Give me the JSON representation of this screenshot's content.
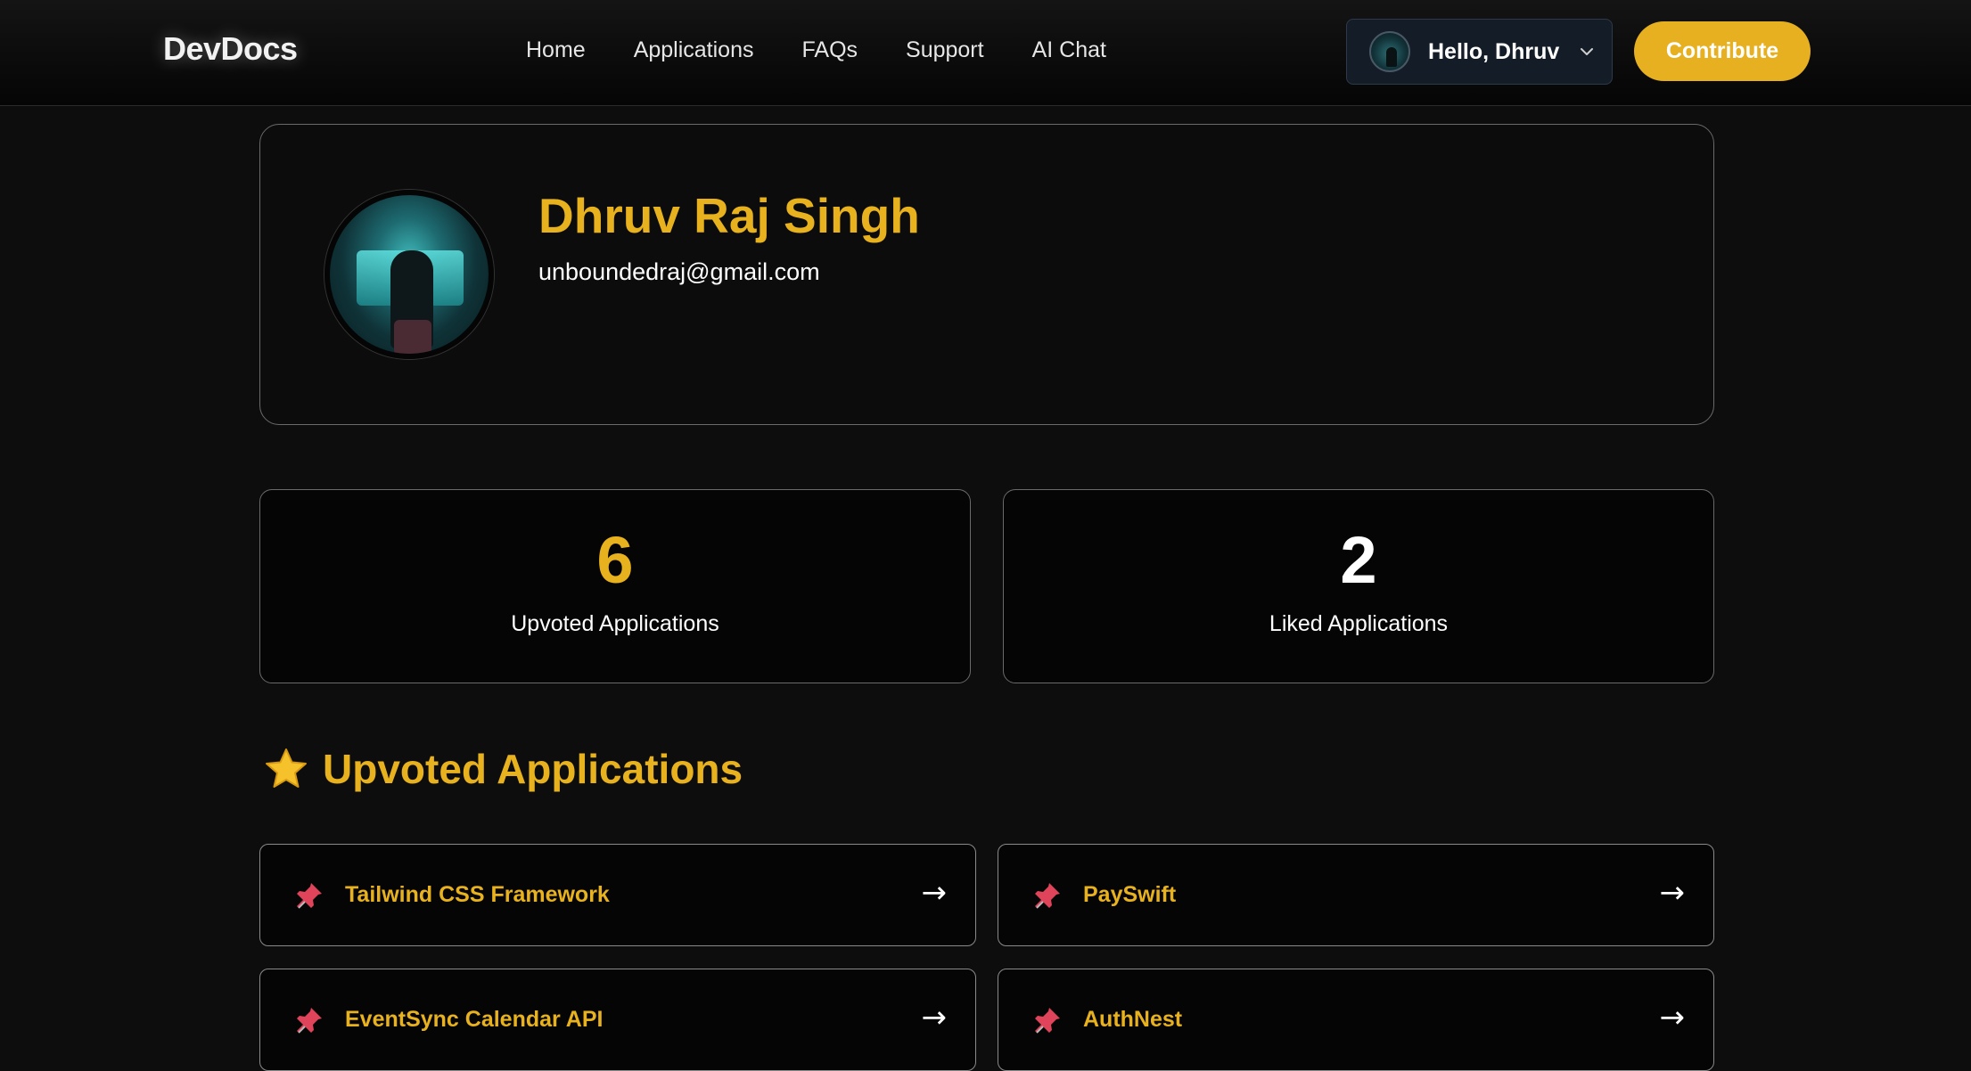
{
  "navbar": {
    "brand": "DevDocs",
    "links": [
      "Home",
      "Applications",
      "FAQs",
      "Support",
      "AI Chat"
    ],
    "user_greeting": "Hello, Dhruv",
    "contribute_label": "Contribute"
  },
  "profile": {
    "name": "Dhruv Raj Singh",
    "email": "unboundedraj@gmail.com"
  },
  "stats": {
    "upvoted": {
      "value": "6",
      "label": "Upvoted Applications",
      "color": "#e8b11e"
    },
    "liked": {
      "value": "2",
      "label": "Liked Applications",
      "color": "#ffffff"
    }
  },
  "section": {
    "icon": "star-icon",
    "title": "Upvoted Applications"
  },
  "applications": [
    {
      "name": "Tailwind CSS Framework",
      "icon": "pin-icon",
      "arrow": "→"
    },
    {
      "name": "PaySwift",
      "icon": "pin-icon",
      "arrow": "→"
    },
    {
      "name": "EventSync Calendar API",
      "icon": "pin-icon",
      "arrow": "→"
    },
    {
      "name": "AuthNest",
      "icon": "pin-icon",
      "arrow": "→"
    }
  ],
  "colors": {
    "accent": "#e8b11e",
    "background": "#0d0d0d",
    "pin": "#e0445a"
  }
}
